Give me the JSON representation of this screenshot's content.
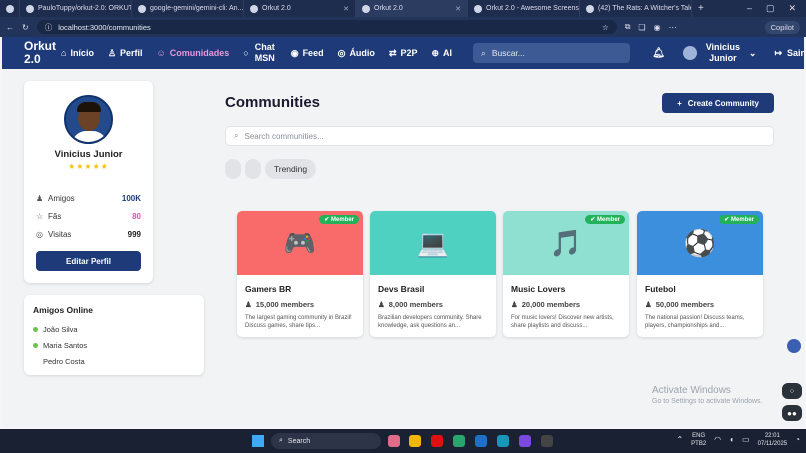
{
  "browser": {
    "tabs": [
      {
        "title": "PauloTuppy/orkut-2.0: ORKUT",
        "active": false
      },
      {
        "title": "google-gemini/gemini-cli: An...",
        "active": false
      },
      {
        "title": "Orkut 2.0",
        "active": false
      },
      {
        "title": "Orkut 2.0",
        "active": true
      },
      {
        "title": "Orkut 2.0 - Awesome Screensh",
        "active": false
      },
      {
        "title": "(42) The Rats: A Witcher's Tale",
        "active": false
      }
    ],
    "url": "localhost:3000/communities",
    "copilot": "Copilot"
  },
  "nav": {
    "logo": "Orkut 2.0",
    "items": [
      {
        "label": "Início",
        "icon": "home-icon",
        "glyph": "⌂",
        "active": false
      },
      {
        "label": "Perfil",
        "icon": "user-icon",
        "glyph": "♙",
        "active": false
      },
      {
        "label": "Comunidades",
        "icon": "users-icon",
        "glyph": "☺",
        "active": true
      },
      {
        "label": "Chat MSN",
        "icon": "chat-icon",
        "glyph": "○",
        "active": false
      },
      {
        "label": "Feed",
        "icon": "feed-icon",
        "glyph": "◉",
        "active": false
      },
      {
        "label": "Áudio",
        "icon": "radio-icon",
        "glyph": "◎",
        "active": false
      },
      {
        "label": "P2P",
        "icon": "p2p-icon",
        "glyph": "⇄",
        "active": false
      },
      {
        "label": "AI",
        "icon": "ai-icon",
        "glyph": "⊕",
        "active": false
      }
    ],
    "search_placeholder": "Buscar...",
    "user_name": "Vinicius Junior",
    "logout": "Sair"
  },
  "profile": {
    "name": "Vinicius Junior",
    "stars": "★★★★★",
    "stats": [
      {
        "label": "Amigos",
        "value": "100K",
        "color": "#1e3a78",
        "icon": "friends-icon",
        "glyph": "♟"
      },
      {
        "label": "Fãs",
        "value": "80",
        "color": "#e34fb0",
        "icon": "star-icon",
        "glyph": "☆"
      },
      {
        "label": "Visitas",
        "value": "999",
        "color": "#222222",
        "icon": "eye-icon",
        "glyph": "◎"
      }
    ],
    "edit_button": "Editar Perfil"
  },
  "friends": {
    "title": "Amigos Online",
    "items": [
      {
        "name": "João Silva",
        "online": true
      },
      {
        "name": "Maria Santos",
        "online": true
      },
      {
        "name": "Pedro Costa",
        "online": false
      }
    ]
  },
  "communities": {
    "title": "Communities",
    "create_button": "Create Community",
    "search_placeholder": "Search communities...",
    "filter_trending": "Trending",
    "cards": [
      {
        "title": "Gamers BR",
        "members": "15,000 members",
        "desc": "The largest gaming community in Brazil! Discuss games, share tips...",
        "badge": "Member",
        "bg": "#f96b6b",
        "icon": "gamepad-icon",
        "glyph": "🎮"
      },
      {
        "title": "Devs Brasil",
        "members": "8,000 members",
        "desc": "Brazilian developers community. Share knowledge, ask questions an...",
        "badge": "",
        "bg": "#4ed1c1",
        "icon": "laptop-icon",
        "glyph": "💻"
      },
      {
        "title": "Music Lovers",
        "members": "20,000 members",
        "desc": "For music lovers! Discover new artists, share playlists and discuss...",
        "badge": "Member",
        "bg": "#8fe0d0",
        "icon": "music-icon",
        "glyph": "🎵"
      },
      {
        "title": "Futebol",
        "members": "50,000 members",
        "desc": "The national passion! Discuss teams, players, championships and...",
        "badge": "Member",
        "bg": "#3b8fdc",
        "icon": "soccer-ball-icon",
        "glyph": "⚽"
      }
    ]
  },
  "watermark": {
    "title": "Activate Windows",
    "sub": "Go to Settings to activate Windows."
  },
  "taskbar": {
    "search": "Search",
    "lang": "ENG",
    "lang2": "PTB2",
    "time": "22:01",
    "date": "07/11/2025"
  }
}
